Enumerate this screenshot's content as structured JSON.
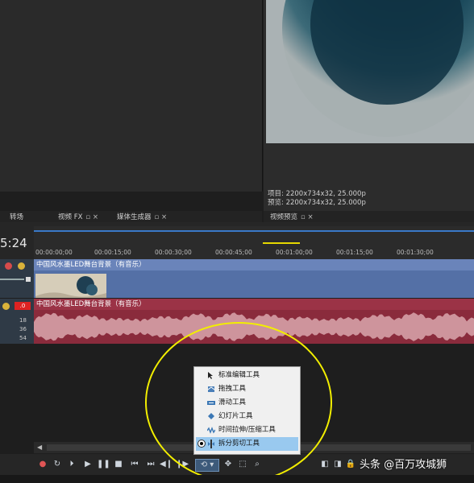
{
  "preview": {
    "project_label": "项目: 2200x734x32, 25.000p",
    "preview_label": "预览: 2200x734x32, 25.000p"
  },
  "tabs": {
    "transitions": "转场",
    "video_fx": "视频 FX",
    "media_generators": "媒体生成器",
    "video_preview": "视频预览",
    "tab_buttons": "▫ ×"
  },
  "timeline": {
    "timecode": "5:24",
    "ruler_labels": [
      "00:00:00;00",
      "00:00:15;00",
      "00:00:30;00",
      "00:00:45;00",
      "00:01:00;00",
      "00:01:15;00",
      "00:01:30;00"
    ],
    "audio_level": ".0",
    "db_labels": [
      "18",
      "36",
      "54"
    ],
    "video_clip_title": "中国风水墨LED舞台背景（有音乐）",
    "audio_clip_title": "中国风水墨LED舞台背景（有音乐）"
  },
  "tool_menu": {
    "items": [
      {
        "label": "标准编辑工具",
        "icon": "normal-edit-tool-icon"
      },
      {
        "label": "拖拽工具",
        "icon": "envelope-tool-icon"
      },
      {
        "label": "滑动工具",
        "icon": "slip-tool-icon"
      },
      {
        "label": "幻灯片工具",
        "icon": "slide-tool-icon"
      },
      {
        "label": "时间拉伸/压缩工具",
        "icon": "time-stretch-tool-icon"
      },
      {
        "label": "拆分剪切工具",
        "icon": "split-trim-tool-icon"
      }
    ],
    "selected_index": 5
  },
  "watermark": "头条 @百万攻城狮",
  "colors": {
    "video_track": "#5470a6",
    "audio_track": "#8a2b3c",
    "highlight": "#f2ee00",
    "menu_selected": "#99c9ef"
  }
}
